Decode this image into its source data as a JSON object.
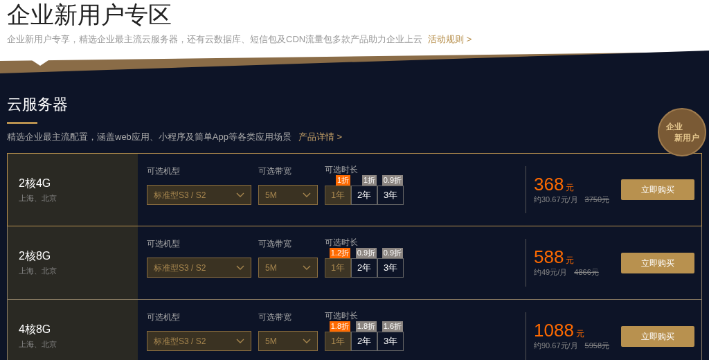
{
  "header": {
    "title": "企业新用户专区",
    "subtitle": "企业新用户专享，精选企业最主流云服务器，还有云数据库、短信包及CDN流量包多款产品助力企业上云",
    "rules_link": "活动规则 >"
  },
  "section": {
    "title": "云服务器",
    "description": "精选企业最主流配置，涵盖web应用、小程序及简单App等各类应用场景",
    "details_link": "产品详情 >",
    "seal": [
      "企业",
      "新用户"
    ]
  },
  "products": [
    {
      "name": "2核4G",
      "regions": "上海、北京",
      "selected": true,
      "model_label": "可选机型",
      "model": "标准型S3 / S2",
      "bandwidth_label": "可选带宽",
      "bandwidth": "5M",
      "duration_label": "可选时长",
      "durations": [
        {
          "label": "1年",
          "tag": "1折",
          "selected": true
        },
        {
          "label": "2年",
          "tag": "1折",
          "selected": false
        },
        {
          "label": "3年",
          "tag": "0.9折",
          "selected": false
        }
      ],
      "price": "368",
      "currency": "元",
      "monthly": "约30.67元/月",
      "original": "3750元",
      "buy": "立即购买"
    },
    {
      "name": "2核8G",
      "regions": "上海、北京",
      "selected": false,
      "model_label": "可选机型",
      "model": "标准型S3 / S2",
      "bandwidth_label": "可选带宽",
      "bandwidth": "5M",
      "duration_label": "可选时长",
      "durations": [
        {
          "label": "1年",
          "tag": "1.2折",
          "selected": true
        },
        {
          "label": "2年",
          "tag": "0.9折",
          "selected": false
        },
        {
          "label": "3年",
          "tag": "0.9折",
          "selected": false
        }
      ],
      "price": "588",
      "currency": "元",
      "monthly": "约49元/月",
      "original": "4866元",
      "buy": "立即购买"
    },
    {
      "name": "4核8G",
      "regions": "上海、北京",
      "selected": false,
      "model_label": "可选机型",
      "model": "标准型S3 / S2",
      "bandwidth_label": "可选带宽",
      "bandwidth": "5M",
      "duration_label": "可选时长",
      "durations": [
        {
          "label": "1年",
          "tag": "1.8折",
          "selected": true
        },
        {
          "label": "2年",
          "tag": "1.8折",
          "selected": false
        },
        {
          "label": "3年",
          "tag": "1.6折",
          "selected": false
        }
      ],
      "price": "1088",
      "currency": "元",
      "monthly": "约90.67元/月",
      "original": "5958元",
      "buy": "立即购买"
    }
  ]
}
